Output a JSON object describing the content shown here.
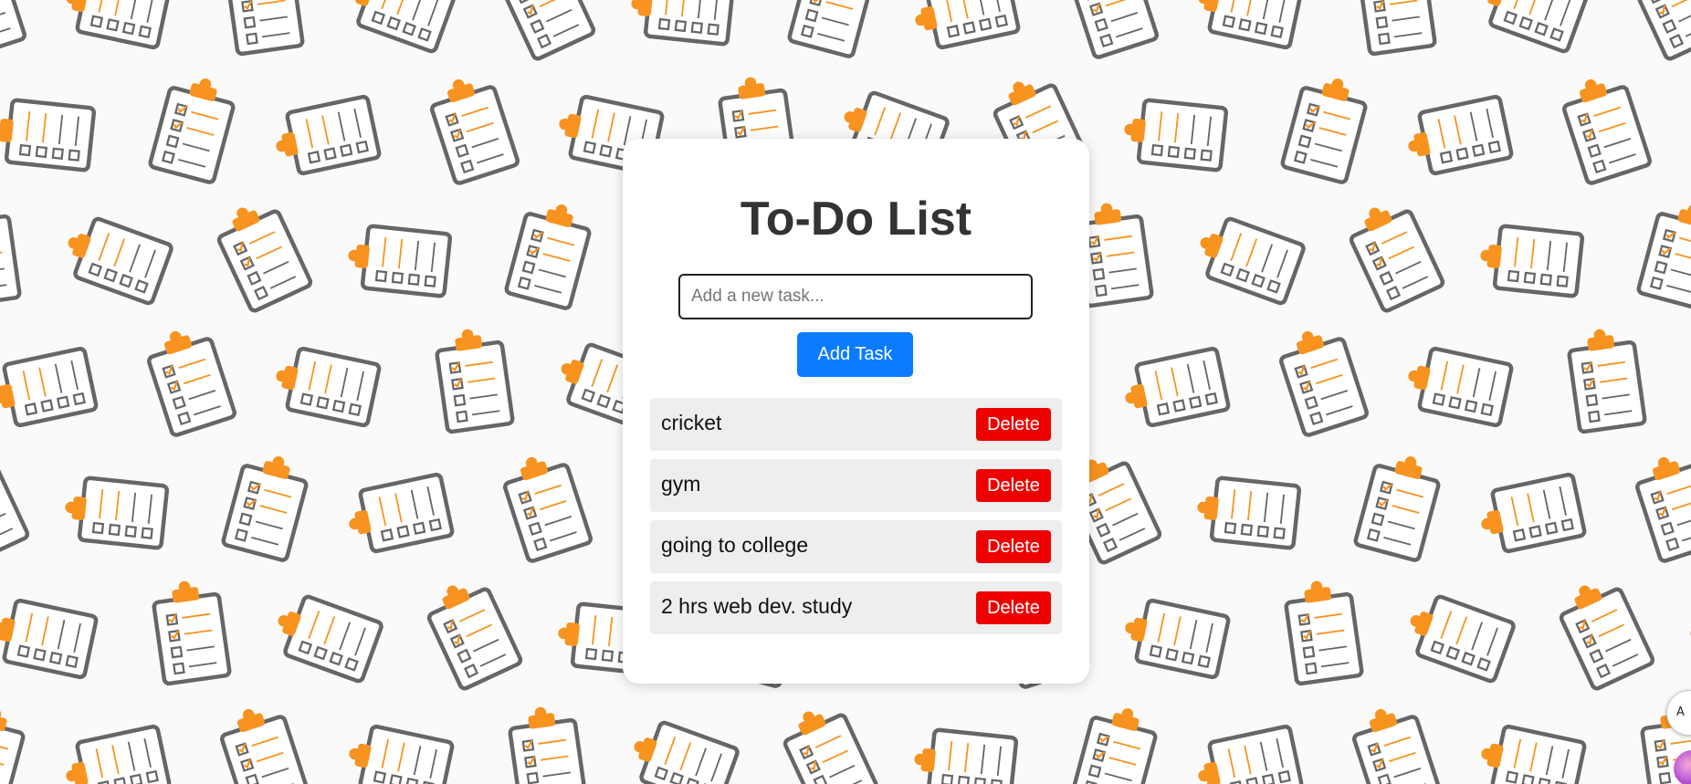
{
  "app": {
    "title": "To-Do List"
  },
  "input": {
    "placeholder": "Add a new task...",
    "value": ""
  },
  "add_button": {
    "label": "Add Task"
  },
  "tasks": [
    {
      "text": "cricket",
      "delete_label": "Delete"
    },
    {
      "text": "gym",
      "delete_label": "Delete"
    },
    {
      "text": "going to college",
      "delete_label": "Delete"
    },
    {
      "text": "2 hrs web dev. study",
      "delete_label": "Delete"
    }
  ],
  "colors": {
    "accent_blue": "#0a7cff",
    "delete_red": "#ee0000",
    "title": "#333333",
    "task_bg": "#eeeeee",
    "pattern_orange": "#f7931e",
    "pattern_gray": "#666666"
  },
  "icons": {
    "background_pattern": "clipboard-checklist-icon",
    "corner_widget": "translate-icon"
  }
}
